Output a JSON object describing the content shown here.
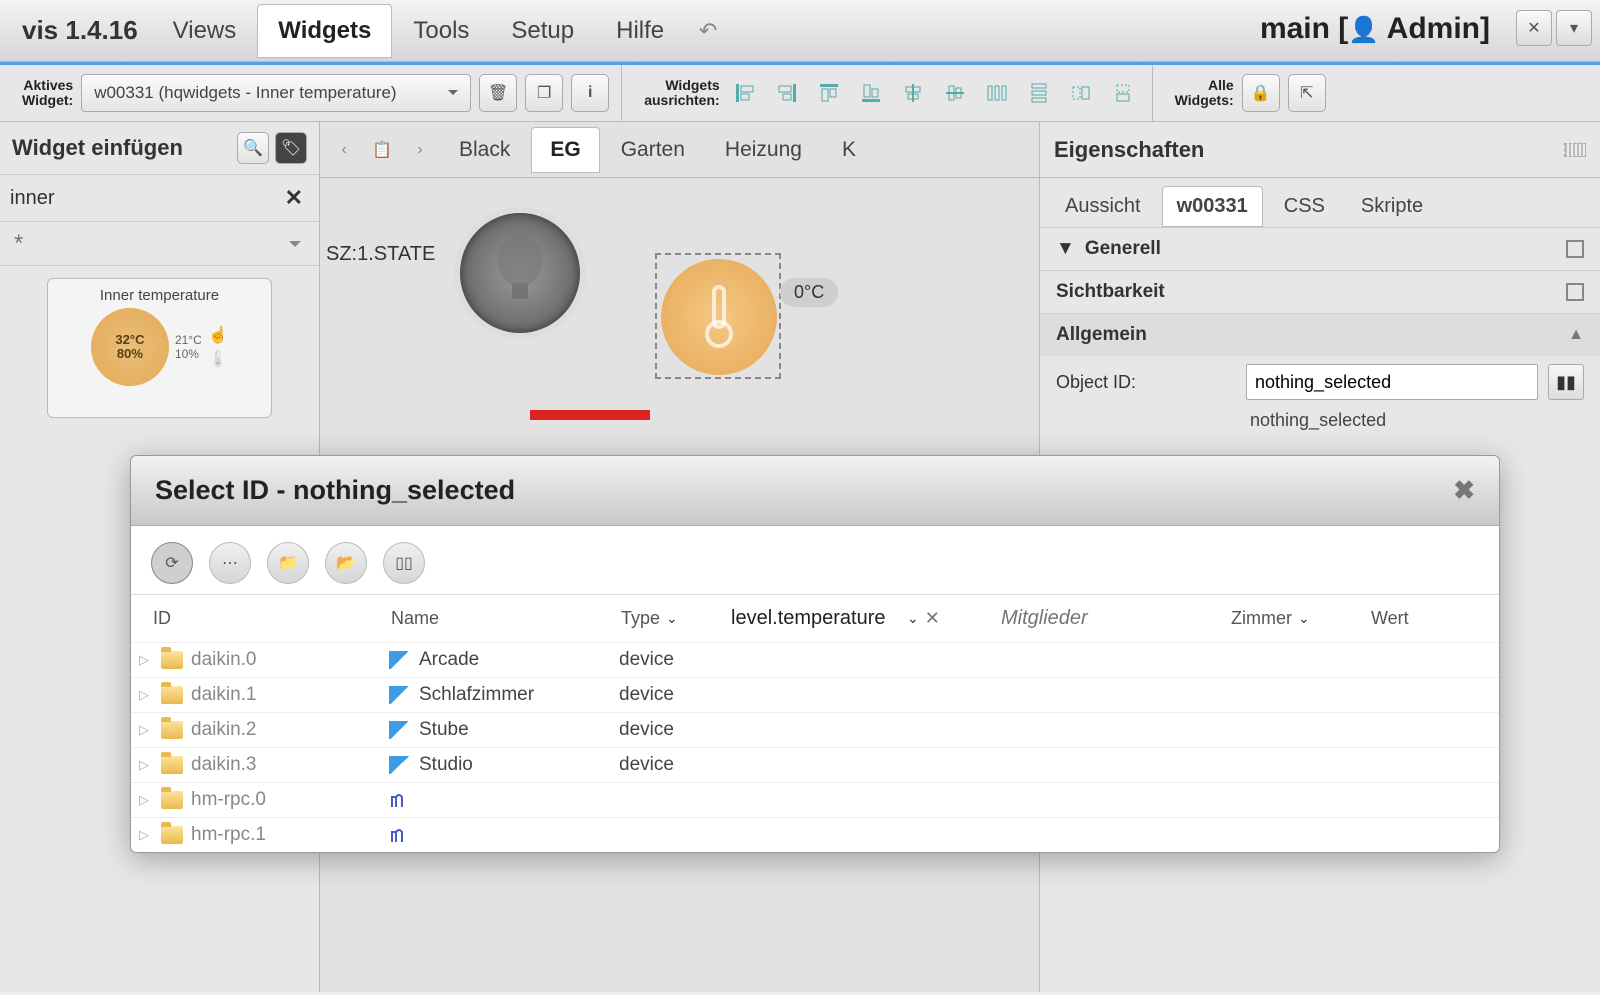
{
  "app": {
    "title": "vis 1.4.16"
  },
  "menubar": {
    "views": "Views",
    "widgets": "Widgets",
    "tools": "Tools",
    "setup": "Setup",
    "help": "Hilfe"
  },
  "header": {
    "main_label": "main",
    "user": "Admin"
  },
  "toolbar": {
    "active_widget_label": "Aktives\nWidget:",
    "active_widget_value": "w00331 (hqwidgets - Inner temperature)",
    "align_label": "Widgets\nausrichten:",
    "all_widgets_label": "Alle\nWidgets:"
  },
  "left_panel": {
    "title": "Widget einfügen",
    "filter_value": "inner",
    "group_filter": "*",
    "card_title": "Inner temperature",
    "card_temp": "32°C",
    "card_hum": "80%",
    "card_small1": "21°C",
    "card_small2": "10%"
  },
  "canvas": {
    "tabs": [
      "Black",
      "EG",
      "Garten",
      "Heizung",
      "K"
    ],
    "active_tab": "EG",
    "state_text": "SZ:1.STATE",
    "temp_badge": "0°C"
  },
  "right_panel": {
    "title": "Eigenschaften",
    "tabs": {
      "view": "Aussicht",
      "widget": "w00331",
      "css": "CSS",
      "scripts": "Skripte"
    },
    "sections": {
      "general": "Generell",
      "visibility": "Sichtbarkeit",
      "common": "Allgemein"
    },
    "object_id_label": "Object ID:",
    "object_id_value": "nothing_selected",
    "object_id_sub": "nothing_selected"
  },
  "dialog": {
    "title": "Select ID - nothing_selected",
    "columns": {
      "id": "ID",
      "name": "Name",
      "type": "Type",
      "role_value": "level.temperature",
      "members": "Mitglieder",
      "room": "Zimmer",
      "value": "Wert"
    },
    "members_placeholder": "Mitglieder",
    "rows": [
      {
        "id": "daikin.0",
        "name": "Arcade",
        "type": "device",
        "icon": "daikin"
      },
      {
        "id": "daikin.1",
        "name": "Schlafzimmer",
        "type": "device",
        "icon": "daikin"
      },
      {
        "id": "daikin.2",
        "name": "Stube",
        "type": "device",
        "icon": "daikin"
      },
      {
        "id": "daikin.3",
        "name": "Studio",
        "type": "device",
        "icon": "daikin"
      },
      {
        "id": "hm-rpc.0",
        "name": "",
        "type": "",
        "icon": "hm"
      },
      {
        "id": "hm-rpc.1",
        "name": "",
        "type": "",
        "icon": "hm"
      }
    ]
  }
}
